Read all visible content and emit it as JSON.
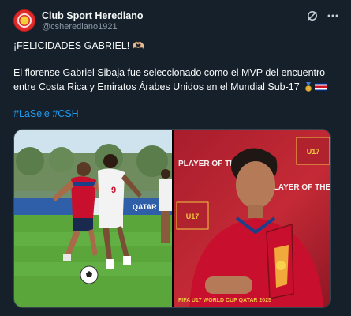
{
  "account": {
    "display_name": "Club Sport Herediano",
    "handle": "@csherediano1921"
  },
  "tweet": {
    "headline": "¡FELICIDADES GABRIEL! 🫶🏼",
    "body": "El florense Gabriel Sibaja fue seleccionado como el MVP del encuentro entre Costa Rica y Emiratos Árabes Unidos en el Mundial Sub-17",
    "hashtags": [
      "#LaSele",
      "#CSH"
    ]
  },
  "icons": {
    "grok": "grok-icon",
    "more": "more-icon",
    "medal": "gold-medal-icon",
    "flag": "costa-rica-flag-icon"
  },
  "media": {
    "left_photo": {
      "shirt_number": "9",
      "board_text": "QATAR"
    },
    "right_photo": {
      "backdrop_titles": [
        "PLAYER OF THE MATCH",
        "PLAYER OF THE MATCH"
      ],
      "event_logo_text": "FIFA U17 WORLD CUP QATAR 2025"
    }
  },
  "colors": {
    "background": "#15202b",
    "text": "#f7f9f9",
    "secondary_text": "#8b98a5",
    "link": "#1d9bf0",
    "costa_rica_red": "#c8102e",
    "uae_white": "#ffffff",
    "pitch_green": "#57a13a",
    "backdrop_red": "#b5202e"
  }
}
